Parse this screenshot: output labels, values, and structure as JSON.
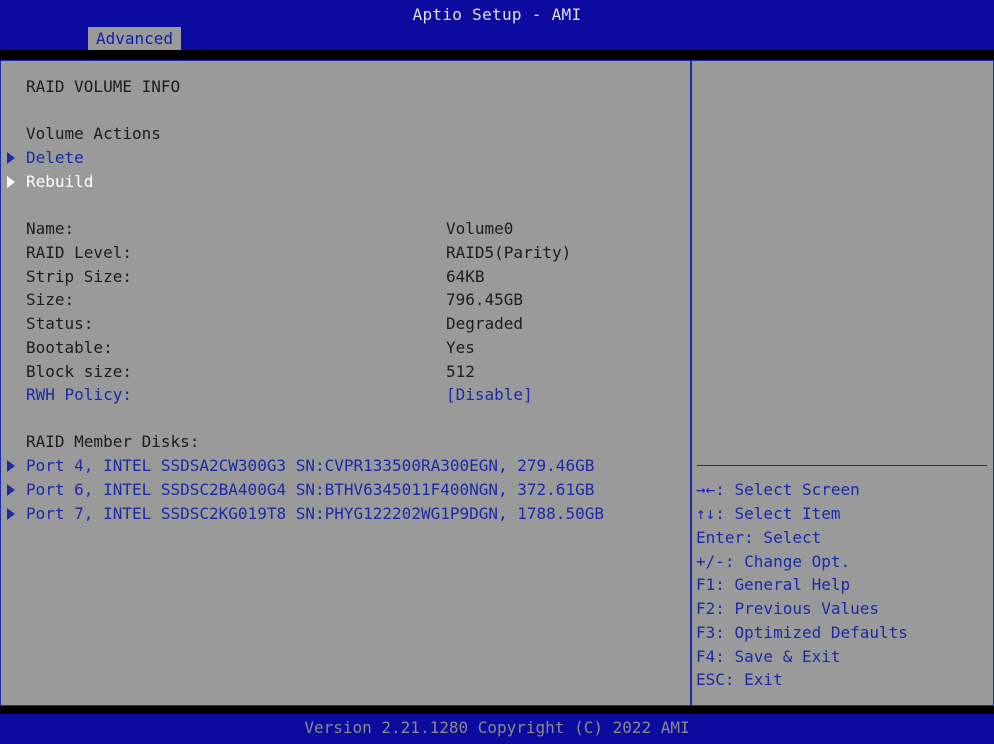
{
  "header": {
    "title": "Aptio Setup - AMI",
    "tab": "Advanced"
  },
  "main": {
    "heading": "RAID VOLUME INFO",
    "actions_heading": "Volume Actions",
    "actions": [
      "Delete",
      "Rebuild"
    ],
    "fields": [
      {
        "label": "Name:",
        "value": "Volume0"
      },
      {
        "label": "RAID Level:",
        "value": "RAID5(Parity)"
      },
      {
        "label": "Strip Size:",
        "value": "64KB"
      },
      {
        "label": "Size:",
        "value": "796.45GB"
      },
      {
        "label": "Status:",
        "value": "Degraded"
      },
      {
        "label": "Bootable:",
        "value": "Yes"
      },
      {
        "label": "Block size:",
        "value": "512"
      },
      {
        "label": "RWH Policy:",
        "value": "[Disable]"
      }
    ],
    "members_heading": "RAID Member Disks:",
    "members": [
      "Port 4, INTEL SSDSA2CW300G3 SN:CVPR133500RA300EGN, 279.46GB",
      "Port 6, INTEL SSDSC2BA400G4 SN:BTHV6345011F400NGN, 372.61GB",
      "Port 7, INTEL SSDSC2KG019T8 SN:PHYG122202WG1P9DGN, 1788.50GB"
    ]
  },
  "help": [
    "→←: Select Screen",
    "↑↓: Select Item",
    "Enter: Select",
    "+/-: Change Opt.",
    "F1: General Help",
    "F2: Previous Values",
    "F3: Optimized Defaults",
    "F4: Save & Exit",
    "ESC: Exit"
  ],
  "footer": {
    "version": "Version 2.21.1280 Copyright (C) 2022 AMI"
  },
  "colors": {
    "header_bg": "#0b0ba0",
    "panel_bg": "#9a9a9a",
    "accent": "#1a2aa8",
    "selected": "#ffffff"
  }
}
